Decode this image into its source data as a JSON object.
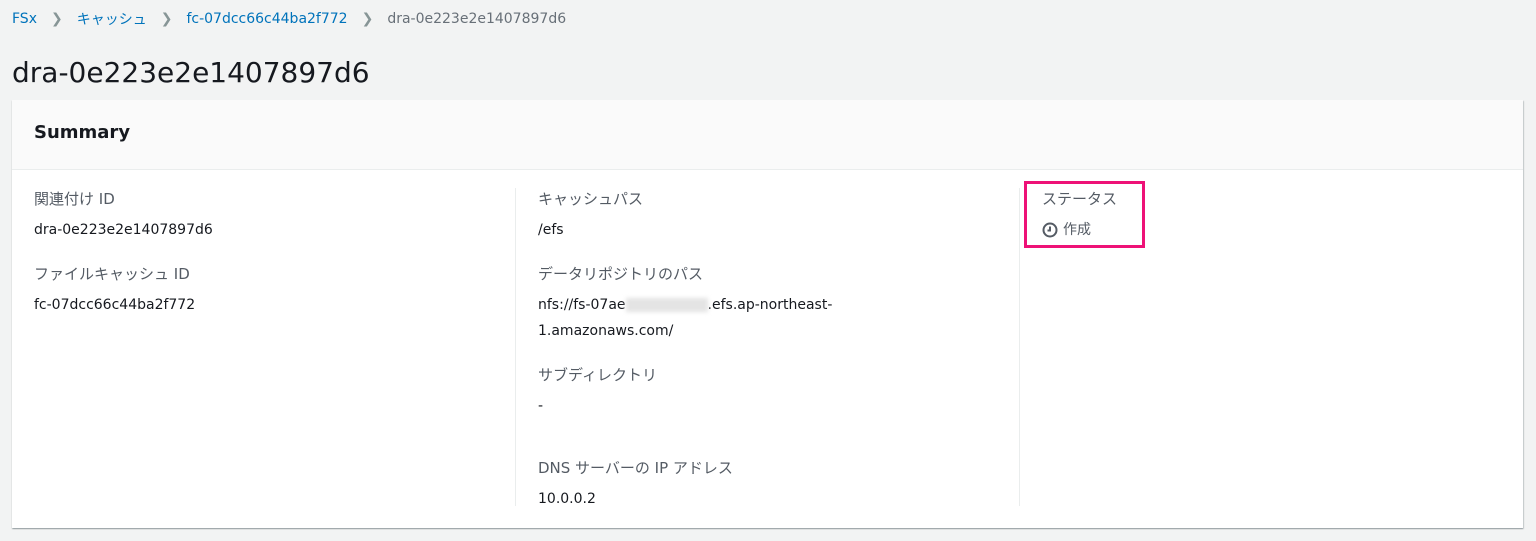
{
  "breadcrumb": {
    "items": [
      "FSx",
      "キャッシュ",
      "fc-07dcc66c44ba2f772"
    ],
    "current": "dra-0e223e2e1407897d6"
  },
  "page_title": "dra-0e223e2e1407897d6",
  "summary": {
    "title": "Summary",
    "association_id_label": "関連付け ID",
    "association_id": "dra-0e223e2e1407897d6",
    "file_cache_id_label": "ファイルキャッシュ ID",
    "file_cache_id": "fc-07dcc66c44ba2f772",
    "cache_path_label": "キャッシュパス",
    "cache_path": "/efs",
    "repo_path_label": "データリポジトリのパス",
    "repo_path_prefix": "nfs://fs-07ae",
    "repo_path_suffix": ".efs.ap-northeast-",
    "repo_path_line2": "1.amazonaws.com/",
    "subdir_label": "サブディレクトリ",
    "subdir": "-",
    "dns_label": "DNS サーバーの IP アドレス",
    "dns": "10.0.0.2",
    "status_label": "ステータス",
    "status": "作成",
    "status_icon": "clock-icon",
    "highlight_color": "#ee1177"
  }
}
